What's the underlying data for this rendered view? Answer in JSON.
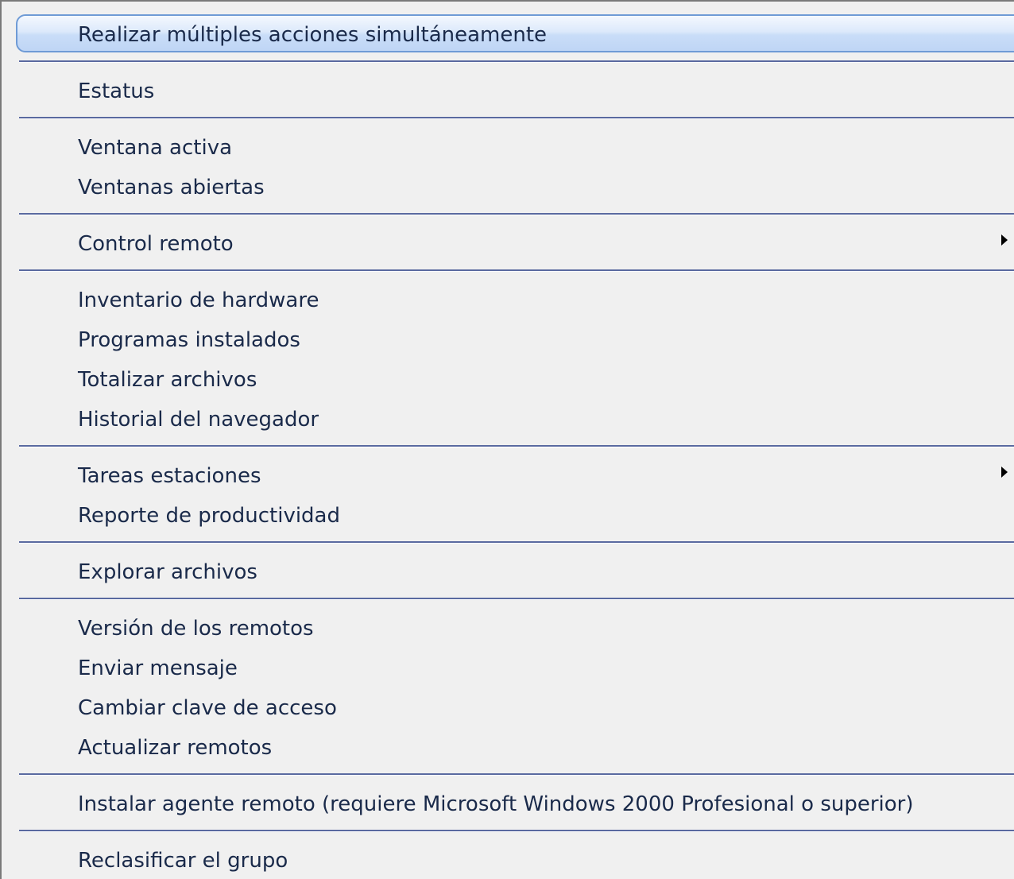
{
  "menu": {
    "items": [
      {
        "label": "Realizar múltiples acciones simultáneamente",
        "highlighted": true
      },
      {
        "label": "Estatus"
      },
      {
        "label": "Ventana activa"
      },
      {
        "label": "Ventanas abiertas"
      },
      {
        "label": "Control remoto",
        "submenu": true
      },
      {
        "label": "Inventario de hardware"
      },
      {
        "label": "Programas instalados"
      },
      {
        "label": "Totalizar archivos"
      },
      {
        "label": "Historial del navegador"
      },
      {
        "label": "Tareas estaciones",
        "submenu": true
      },
      {
        "label": "Reporte de productividad"
      },
      {
        "label": "Explorar archivos"
      },
      {
        "label": "Versión de los remotos"
      },
      {
        "label": "Enviar mensaje"
      },
      {
        "label": "Cambiar clave de acceso"
      },
      {
        "label": "Actualizar remotos"
      },
      {
        "label": "Instalar agente remoto (requiere Microsoft Windows 2000 Profesional o superior)"
      },
      {
        "label": "Reclasificar el grupo"
      }
    ]
  },
  "colors": {
    "highlight_border": "#6f9bd6",
    "separator": "#5a6aa0",
    "text": "#1a2a4a",
    "background": "#f0f0f0"
  },
  "icons": {
    "submenu": "chevron-right-icon"
  }
}
